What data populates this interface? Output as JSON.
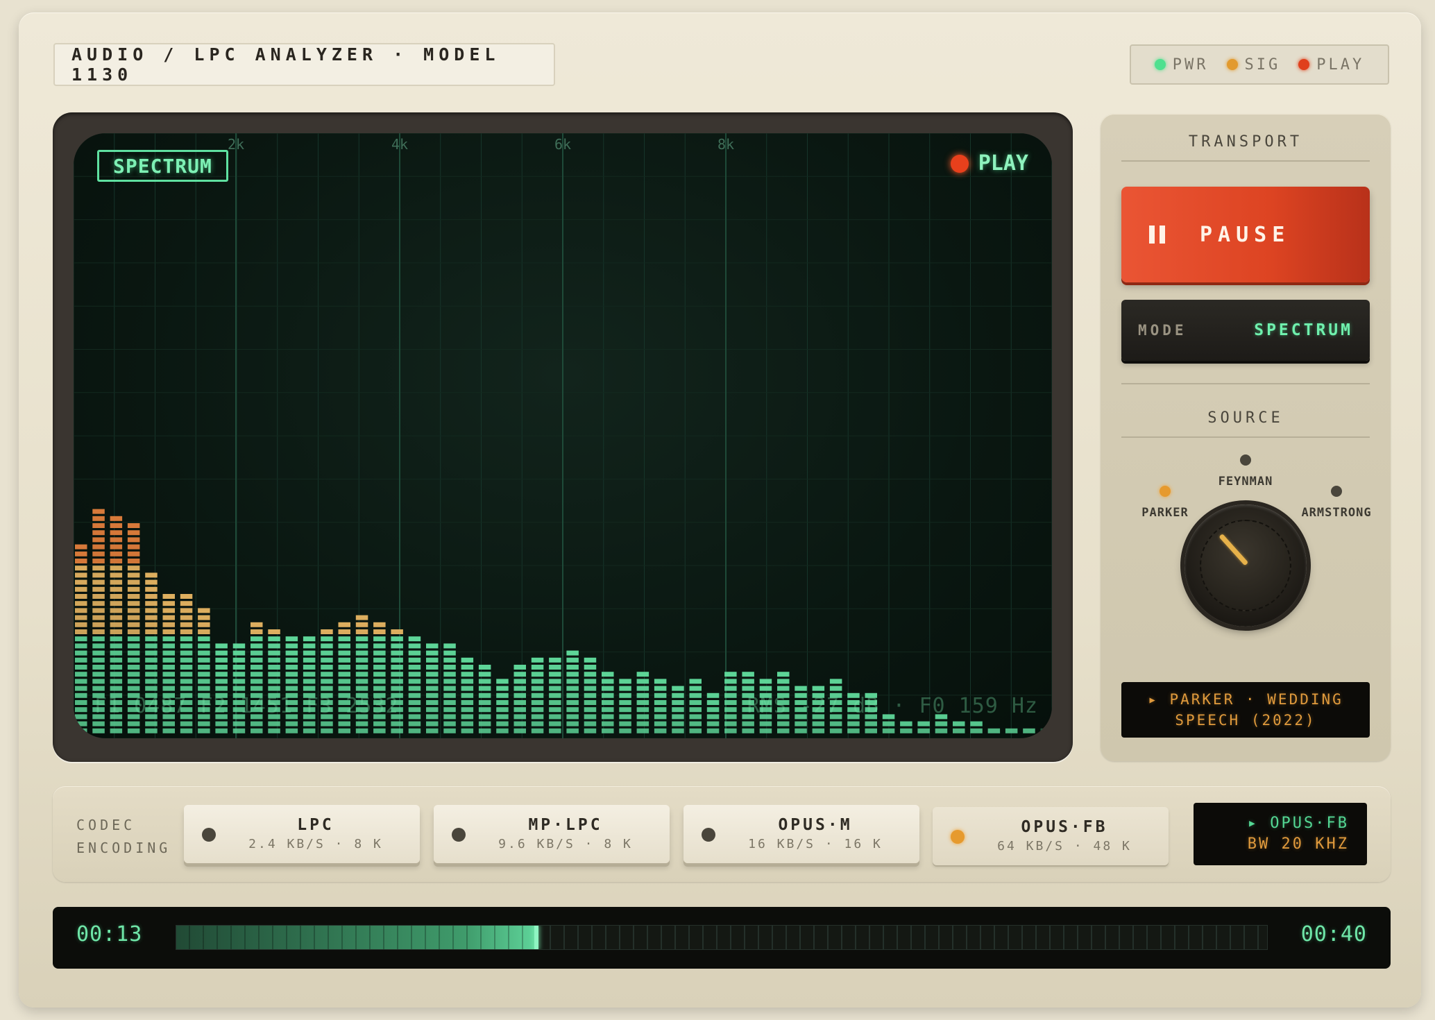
{
  "header": {
    "title": "AUDIO / LPC ANALYZER · MODEL 1130",
    "status": [
      {
        "label": "PWR",
        "color": "#4fe08f"
      },
      {
        "label": "SIG",
        "color": "#e29a2e"
      },
      {
        "label": "PLAY",
        "color": "#e0401c"
      }
    ]
  },
  "screen": {
    "mode_label": "SPECTRUM",
    "play_label": "PLAY",
    "freq_ticks": [
      "2k",
      "4k",
      "6k",
      "8k"
    ],
    "readout_left": "F1 0487 F2 1451 F3 2532",
    "readout_right": "RMS -27 dB · F0 159 Hz",
    "spectrum_levels": [
      27,
      32,
      31,
      30,
      23,
      20,
      20,
      18,
      13,
      13,
      16,
      15,
      14,
      14,
      15,
      16,
      17,
      16,
      15,
      14,
      13,
      13,
      11,
      10,
      8,
      10,
      11,
      11,
      12,
      11,
      9,
      8,
      9,
      8,
      7,
      8,
      6,
      9,
      9,
      8,
      9,
      7,
      7,
      8,
      6,
      6,
      3,
      2,
      2,
      3,
      2,
      2,
      1,
      1,
      1,
      0
    ],
    "warm_threshold": 14,
    "max_level": 36,
    "colors": {
      "green": "#5fd89a",
      "amber": "#e0b060",
      "orange": "#d97a3a"
    }
  },
  "transport": {
    "title": "TRANSPORT",
    "pause_label": "PAUSE",
    "mode_key": "MODE",
    "mode_value": "SPECTRUM"
  },
  "source": {
    "title": "SOURCE",
    "options": [
      {
        "label": "PARKER",
        "active": true
      },
      {
        "label": "FEYNMAN",
        "active": false
      },
      {
        "label": "ARMSTRONG",
        "active": false
      }
    ],
    "display_line1": "▸ PARKER · WEDDING",
    "display_line2": "SPEECH (2022)"
  },
  "codec": {
    "title_line1": "CODEC",
    "title_line2": "ENCODING",
    "options": [
      {
        "name": "LPC",
        "rate": "2.4 KB/S · 8 K",
        "active": false
      },
      {
        "name": "MP·LPC",
        "rate": "9.6 KB/S · 8 K",
        "active": false
      },
      {
        "name": "OPUS·M",
        "rate": "16 KB/S · 16 K",
        "active": false
      },
      {
        "name": "OPUS·FB",
        "rate": "64 KB/S · 48 K",
        "active": true
      }
    ],
    "display_line1": "▸ OPUS·FB",
    "display_line2": "BW 20 KHZ",
    "display_line1_color": "#54d894",
    "display_line2_color": "#e09a3c"
  },
  "timeline": {
    "current": "00:13",
    "total": "00:40",
    "progress": 0.33
  }
}
